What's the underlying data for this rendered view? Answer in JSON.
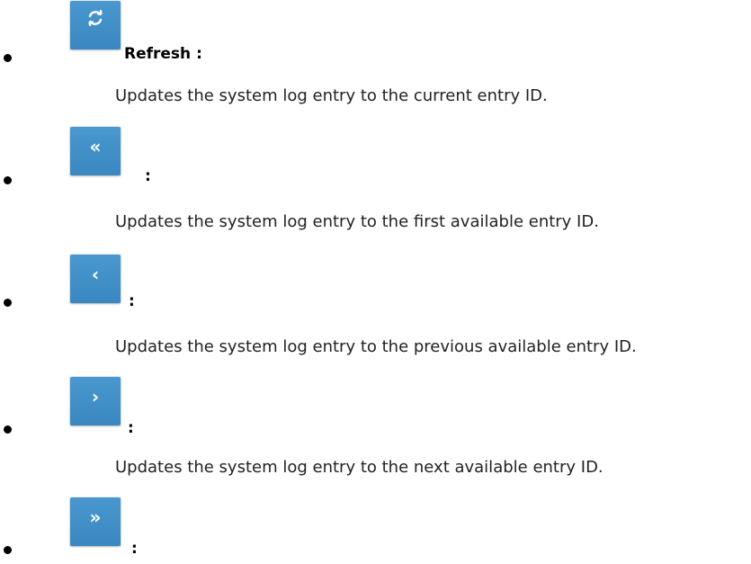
{
  "items": [
    {
      "icon": "refresh-icon",
      "label": "Refresh :",
      "description": "Updates the system log entry to the current entry ID."
    },
    {
      "icon": "double-chevron-left-icon",
      "glyph": "«",
      "label": ":",
      "description": "Updates the system log entry to the first available entry ID."
    },
    {
      "icon": "chevron-left-icon",
      "glyph": "‹",
      "label": ":",
      "description": "Updates the system log entry to the previous available entry ID."
    },
    {
      "icon": "chevron-right-icon",
      "glyph": "›",
      "label": ":",
      "description": "Updates the system log entry to the next available entry ID."
    },
    {
      "icon": "double-chevron-right-icon",
      "glyph": "»",
      "label": ":"
    }
  ],
  "colors": {
    "button": "#3a87c1",
    "text": "#222222"
  }
}
